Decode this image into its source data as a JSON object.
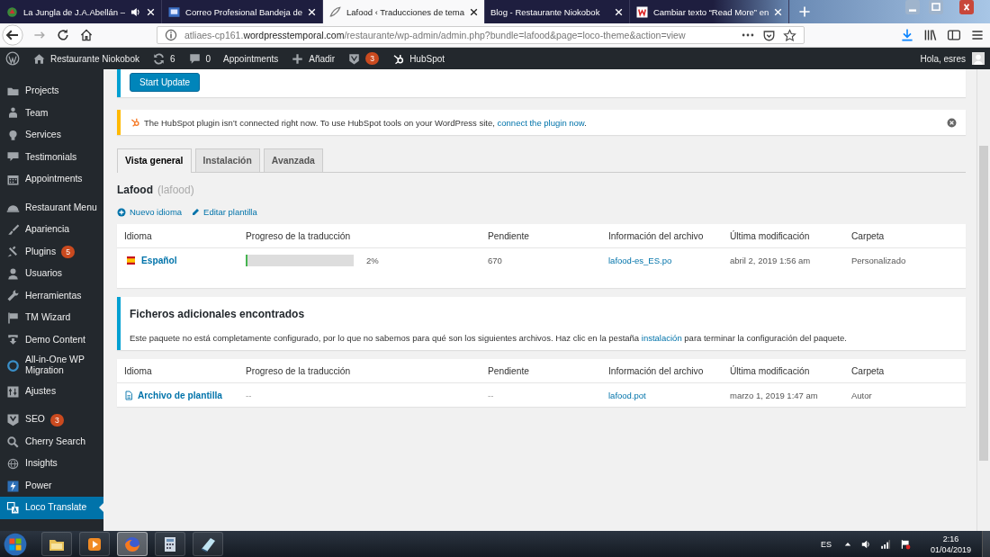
{
  "browser": {
    "tabs": [
      {
        "title": "La Jungla de J.A.Abellán –",
        "selected": false,
        "audio": true
      },
      {
        "title": "Correo Profesional Bandeja de",
        "selected": false,
        "audio": false
      },
      {
        "title": "Lafood ‹ Traducciones de tema",
        "selected": true,
        "audio": false
      },
      {
        "title": "Blog - Restaurante Niokobok",
        "selected": false,
        "audio": false
      },
      {
        "title": "Cambiar texto “Read More” en",
        "selected": false,
        "audio": false
      }
    ],
    "address": {
      "prefix": "atliaes-cp161.",
      "domain": "wordpresstemporal.com",
      "path": "/restaurante/wp-admin/admin.php?bundle=lafood&page=loco-theme&action=view"
    }
  },
  "admin_bar": {
    "site": "Restaurante Niokobok",
    "updates": "6",
    "comments": "0",
    "appointments": "Appointments",
    "add": "Añadir",
    "seo_badge": "3",
    "hubspot": "HubSpot",
    "greeting": "Hola, esres"
  },
  "sidebar": {
    "groups": [
      [
        {
          "label": "Projects",
          "selected": false
        },
        {
          "label": "Team",
          "selected": false
        },
        {
          "label": "Services",
          "selected": false
        },
        {
          "label": "Testimonials",
          "selected": false
        },
        {
          "label": "Appointments",
          "selected": false
        }
      ],
      [
        {
          "label": "Restaurant Menu",
          "selected": false
        },
        {
          "label": "Apariencia",
          "selected": false
        },
        {
          "label": "Plugins",
          "selected": false,
          "badge": "5"
        },
        {
          "label": "Usuarios",
          "selected": false
        },
        {
          "label": "Herramientas",
          "selected": false
        },
        {
          "label": "TM Wizard",
          "selected": false
        },
        {
          "label": "Demo Content",
          "selected": false
        },
        {
          "label": "All-in-One WP Migration",
          "selected": false
        },
        {
          "label": "Ajustes",
          "selected": false
        }
      ],
      [
        {
          "label": "SEO",
          "selected": false,
          "badge": "3"
        },
        {
          "label": "Cherry Search",
          "selected": false
        },
        {
          "label": "Insights",
          "selected": false
        },
        {
          "label": "Power",
          "selected": false
        },
        {
          "label": "Loco Translate",
          "selected": true
        }
      ]
    ]
  },
  "update_notice": {
    "button": "Start Update"
  },
  "hubspot_notice": {
    "text": "The HubSpot plugin isn’t connected right now. To use HubSpot tools on your WordPress site, ",
    "link": "connect the plugin now",
    "end": "."
  },
  "tabs": [
    {
      "label": "Vista general",
      "selected": true
    },
    {
      "label": "Instalación",
      "selected": false
    },
    {
      "label": "Avanzada",
      "selected": false
    }
  ],
  "bundle": {
    "name": "Lafood",
    "slug": "(lafood)"
  },
  "actions": [
    {
      "label": "Nuevo idioma",
      "kind": "add"
    },
    {
      "label": "Editar plantilla",
      "kind": "edit"
    }
  ],
  "languages_table": {
    "columns": [
      "Idioma",
      "Progreso de la traducción",
      "Pendiente",
      "Información del archivo",
      "Última modificación",
      "Carpeta"
    ],
    "rows": [
      {
        "kind": "locale",
        "name": "Español",
        "level": 0.02,
        "percent": "2%",
        "pending": "670",
        "file": "lafood-es_ES.po",
        "modified": "abril 2, 2019 1:56 am",
        "folder": "Personalizado"
      }
    ]
  },
  "extra_notice": {
    "title": "Ficheros adicionales encontrados",
    "text": "Este paquete no está completamente configurado, por lo que no sabemos para qué son los siguientes archivos. Haz clic en la pestaña ",
    "link": "instalación",
    "end": " para terminar la configuración del paquete."
  },
  "extra_table": {
    "columns": [
      "Idioma",
      "Progreso de la traducción",
      "Pendiente",
      "Información del archivo",
      "Última modificación",
      "Carpeta"
    ],
    "rows": [
      {
        "kind": "template",
        "name": "Archivo de plantilla",
        "progress": "--",
        "pending": "--",
        "file": "lafood.pot",
        "modified": "marzo 1, 2019 1:47 am",
        "folder": "Autor"
      }
    ]
  },
  "taskbar": {
    "apps": [
      {
        "selected": false
      },
      {
        "selected": false
      },
      {
        "selected": true
      },
      {
        "selected": false
      },
      {
        "selected": false
      }
    ]
  },
  "tray": {
    "language": "ES",
    "time": "2:16",
    "date": "01/04/2019"
  }
}
